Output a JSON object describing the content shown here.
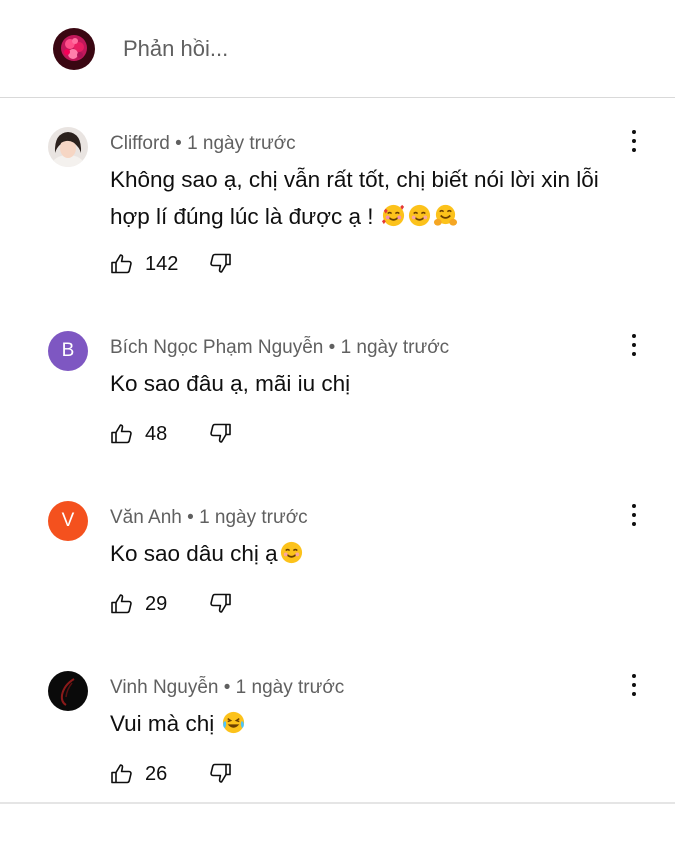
{
  "reply": {
    "placeholder": "Phản hồi..."
  },
  "comments": [
    {
      "author": "Clifford",
      "time": "1 ngày trước",
      "avatar_letter": "",
      "avatar_color": "",
      "text": "Không sao ạ, chị vẫn rất tốt, chị biết nói lời xin lỗi hợp lí đúng lúc là được ạ !",
      "likes": "142",
      "emojis": [
        "smiling-face-with-hearts",
        "smiling-face",
        "hugging-face"
      ]
    },
    {
      "author": "Bích Ngọc Phạm Nguyễn",
      "time": "1 ngày trước",
      "avatar_letter": "B",
      "avatar_color": "#7e57c2",
      "text": "Ko sao đâu ạ, mãi iu chị",
      "likes": "48",
      "emojis": []
    },
    {
      "author": "Văn Anh",
      "time": "1 ngày trước",
      "avatar_letter": "V",
      "avatar_color": "#f4511e",
      "text": "Ko sao dâu chị ạ",
      "likes": "29",
      "emojis": [
        "smiling-face"
      ]
    },
    {
      "author": "Vinh Nguyễn",
      "time": "1 ngày trước",
      "avatar_letter": "",
      "avatar_color": "",
      "text": "Vui mà chị",
      "likes": "26",
      "emojis": [
        "face-with-tears-of-joy"
      ]
    }
  ],
  "icons": {
    "like": "thumb-up-icon",
    "dislike": "thumb-down-icon",
    "menu": "more-vertical-icon"
  },
  "colors": {
    "text": "#0f0f0f",
    "secondary": "#606060",
    "divider": "#d9d9d9"
  }
}
